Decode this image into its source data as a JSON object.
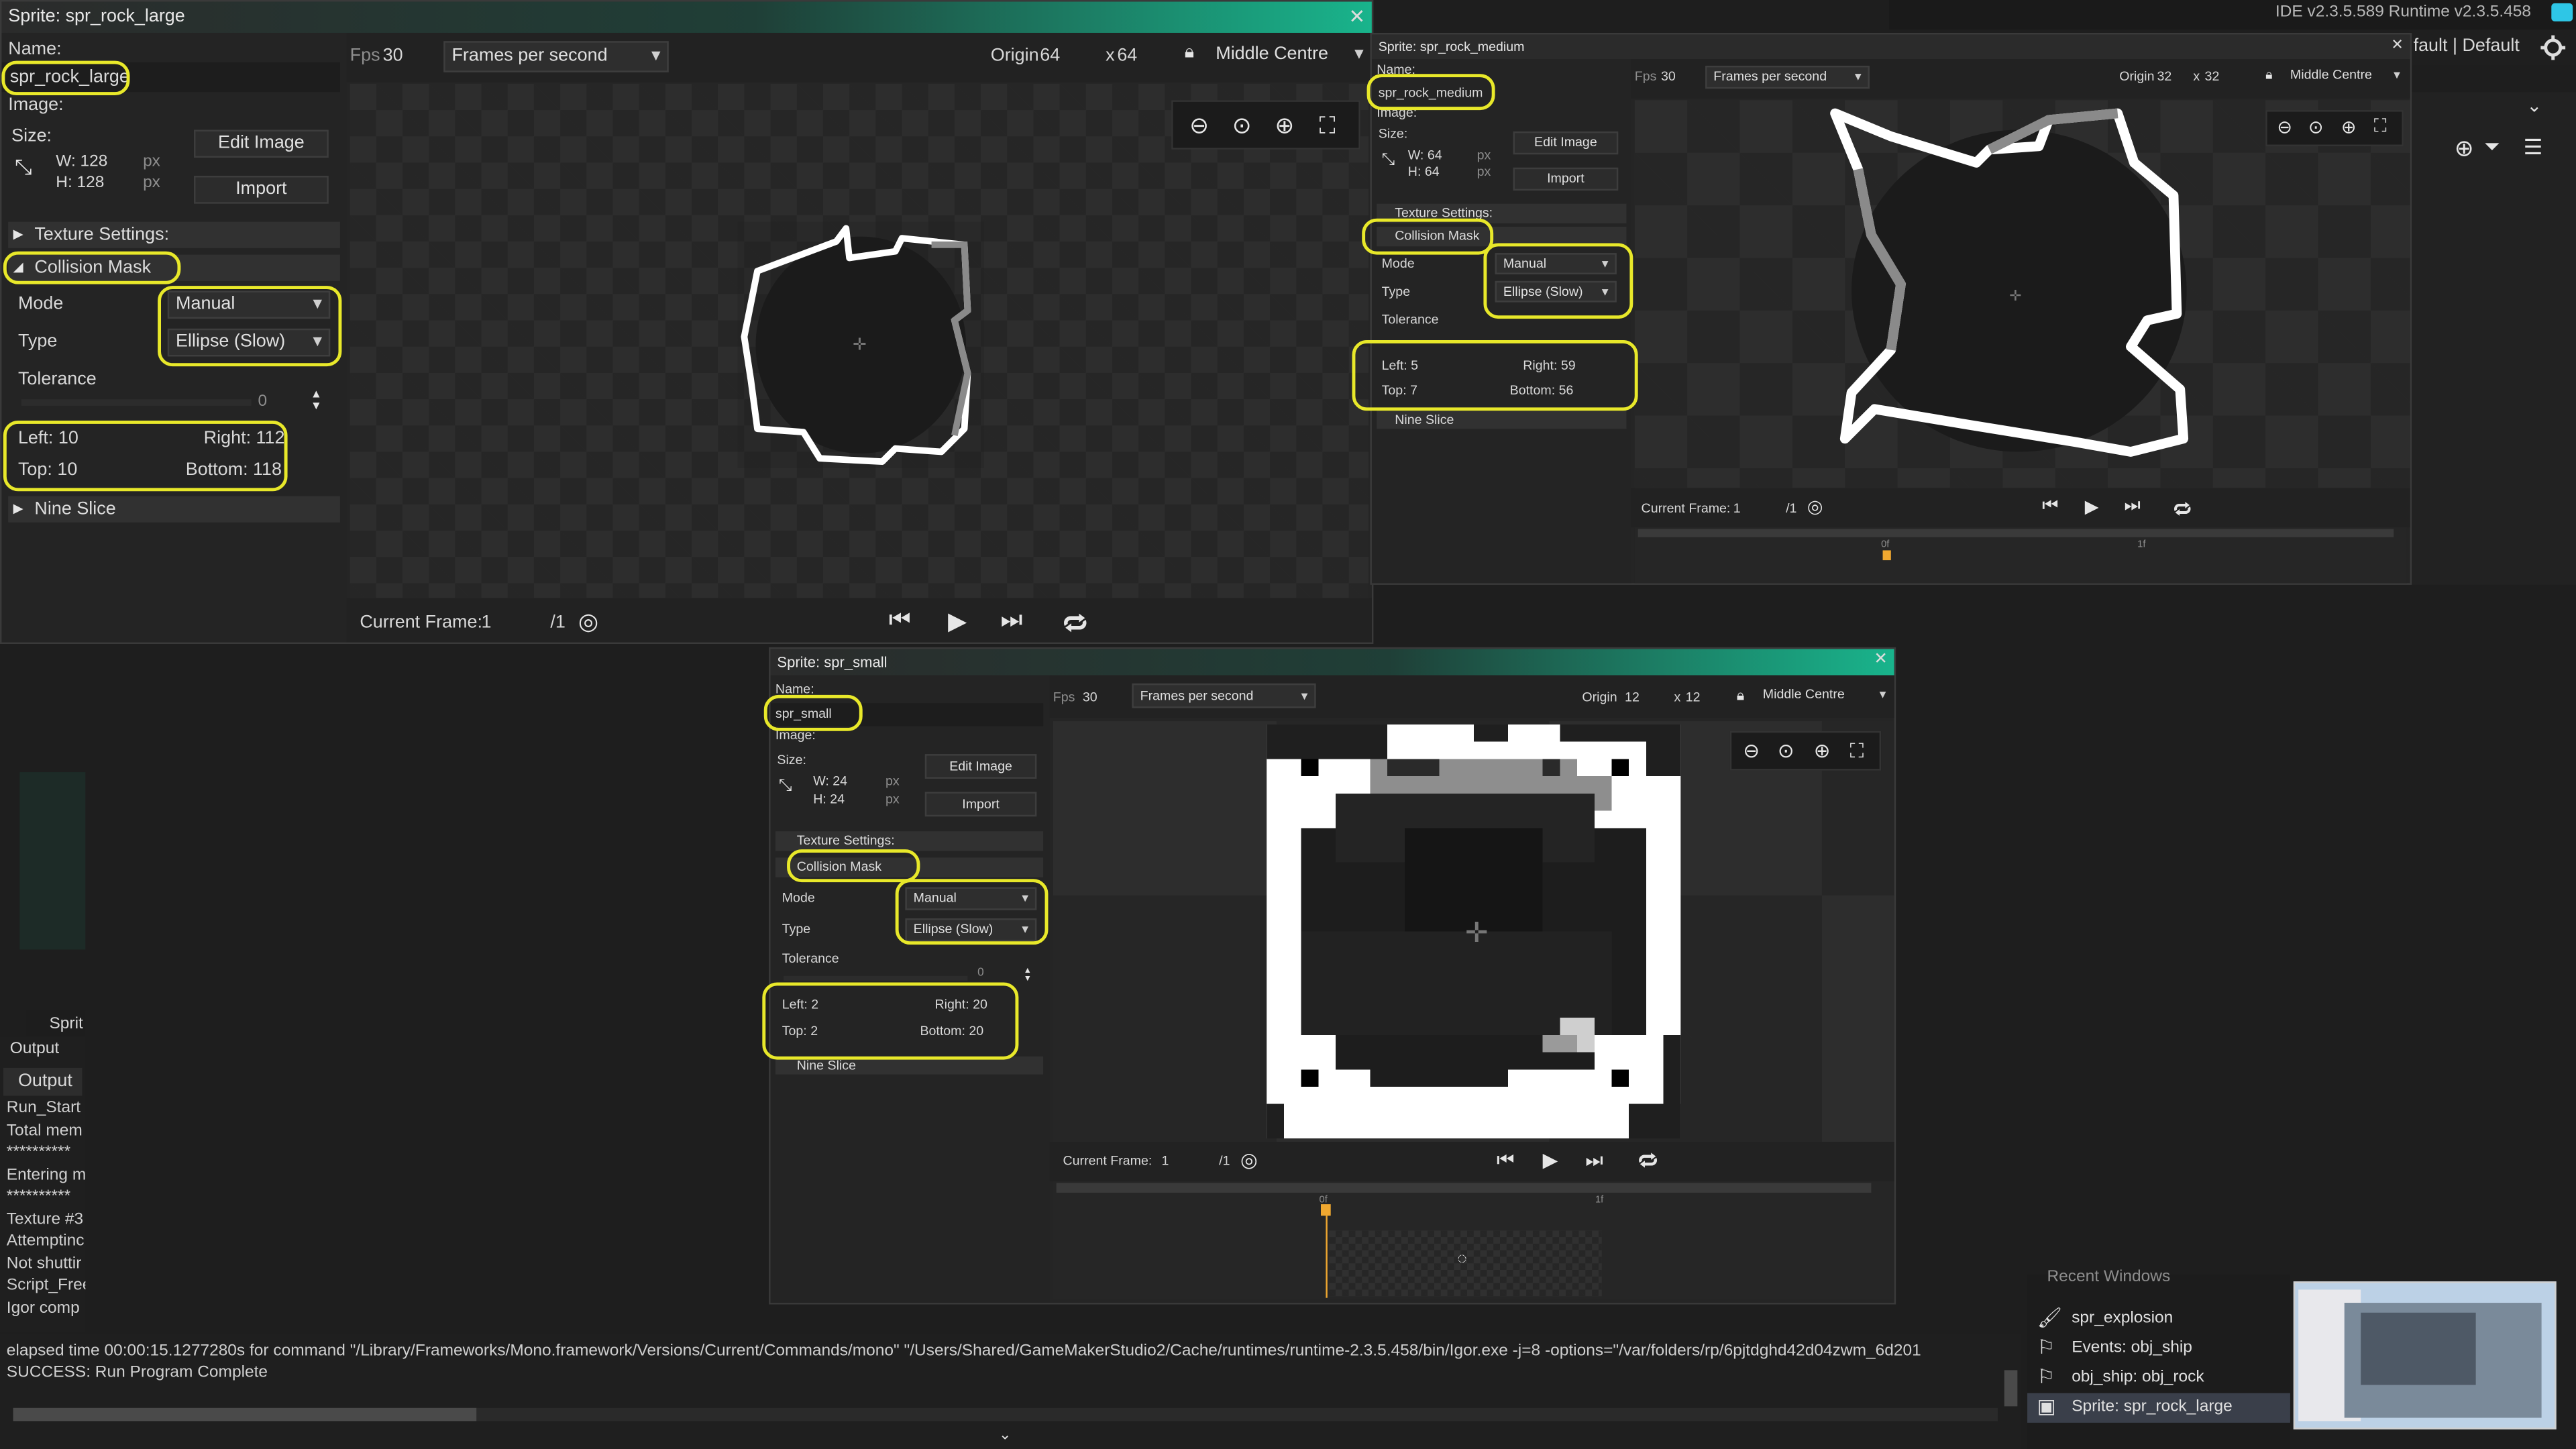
{
  "ide_header": {
    "versions": "IDE v2.3.5.589  Runtime v2.3.5.458",
    "layout_partial": "fault | Default"
  },
  "large": {
    "title": "Sprite: spr_rock_large",
    "name_label": "Name:",
    "name_value": "spr_rock_large",
    "image_label": "Image:",
    "size_label": "Size:",
    "w": "W: 128",
    "h": "H: 128",
    "px": "px",
    "edit_image": "Edit Image",
    "import": "Import",
    "texture_settings": "Texture Settings:",
    "collision_mask": "Collision Mask",
    "mode_label": "Mode",
    "mode_value": "Manual",
    "type_label": "Type",
    "type_value": "Ellipse (Slow)",
    "tolerance_label": "Tolerance",
    "tolerance_value": "0",
    "left": "Left: 10",
    "right": "Right: 112",
    "top": "Top: 10",
    "bottom": "Bottom: 118",
    "nine_slice": "Nine Slice",
    "fps_label": "Fps",
    "fps_value": "30",
    "fps_unit": "Frames per second",
    "origin_label": "Origin",
    "origin_x": "64",
    "origin_sep": "x",
    "origin_y": "64",
    "origin_preset": "Middle Centre",
    "current_frame_label": "Current Frame:",
    "current_frame_value": "1",
    "frame_total": "/1"
  },
  "medium": {
    "title": "Sprite: spr_rock_medium",
    "name_label": "Name:",
    "name_value": "spr_rock_medium",
    "image_label": "Image:",
    "size_label": "Size:",
    "w": "W: 64",
    "h": "H: 64",
    "px": "px",
    "edit_image": "Edit Image",
    "import": "Import",
    "texture_settings": "Texture Settings:",
    "collision_mask": "Collision Mask",
    "mode_label": "Mode",
    "mode_value": "Manual",
    "type_label": "Type",
    "type_value": "Ellipse (Slow)",
    "tolerance_label": "Tolerance",
    "left": "Left: 5",
    "right": "Right: 59",
    "top": "Top: 7",
    "bottom": "Bottom: 56",
    "nine_slice": "Nine Slice",
    "fps_label": "Fps",
    "fps_value": "30",
    "fps_unit": "Frames per second",
    "origin_label": "Origin",
    "origin_x": "32",
    "origin_sep": "x",
    "origin_y": "32",
    "origin_preset": "Middle Centre",
    "current_frame_label": "Current Frame:",
    "current_frame_value": "1",
    "frame_total": "/1",
    "timeline_start": "0f",
    "timeline_mid": "1f"
  },
  "small": {
    "title": "Sprite: spr_small",
    "name_label": "Name:",
    "name_value": "spr_small",
    "image_label": "Image:",
    "size_label": "Size:",
    "w": "W: 24",
    "h": "H: 24",
    "px": "px",
    "edit_image": "Edit Image",
    "import": "Import",
    "texture_settings": "Texture Settings:",
    "collision_mask": "Collision Mask",
    "mode_label": "Mode",
    "mode_value": "Manual",
    "type_label": "Type",
    "type_value": "Ellipse (Slow)",
    "tolerance_label": "Tolerance",
    "tolerance_value": "0",
    "left": "Left: 2",
    "right": "Right: 20",
    "top": "Top: 2",
    "bottom": "Bottom: 20",
    "nine_slice": "Nine Slice",
    "fps_label": "Fps",
    "fps_value": "30",
    "fps_unit": "Frames per second",
    "origin_label": "Origin",
    "origin_x": "12",
    "origin_sep": "x",
    "origin_y": "12",
    "origin_preset": "Middle Centre",
    "current_frame_label": "Current Frame:",
    "current_frame_value": "1",
    "frame_total": "/1",
    "timeline_start": "0f",
    "timeline_mid": "1f"
  },
  "output": {
    "panel_label": "Output",
    "tab_label": "Output",
    "sprite_tab_partial": "Sprit",
    "lines": [
      "Run_Start",
      "Total mem",
      "**********",
      "Entering m",
      "**********",
      "Texture #3",
      "Attemptinc",
      "Not shuttir",
      "Script_Free",
      "Igor comp"
    ],
    "elapsed": "elapsed time 00:00:15.1277280s for command \"/Library/Frameworks/Mono.framework/Versions/Current/Commands/mono\" \"/Users/Shared/GameMakerStudio2/Cache/runtimes/runtime-2.3.5.458/bin/Igor.exe -j=8 -options=\"/var/folders/rp/6pjtdghd42d04zwm_6d201",
    "success": "SUCCESS: Run Program Complete"
  },
  "recent_windows": {
    "header_partial": "Recent Windows",
    "items": [
      {
        "label": "spr_explosion",
        "icon": "brush-icon"
      },
      {
        "label": "Events: obj_ship",
        "icon": "flag-icon"
      },
      {
        "label": "obj_ship: obj_rock",
        "icon": "flag-icon"
      },
      {
        "label": "Sprite: spr_rock_large",
        "icon": "sprite-icon"
      }
    ]
  },
  "colors": {
    "highlight": "#e8e82a",
    "accent": "#19b48c",
    "panel": "#252525",
    "canvas_dark": "#262626",
    "canvas_light": "#2d2d2d"
  }
}
